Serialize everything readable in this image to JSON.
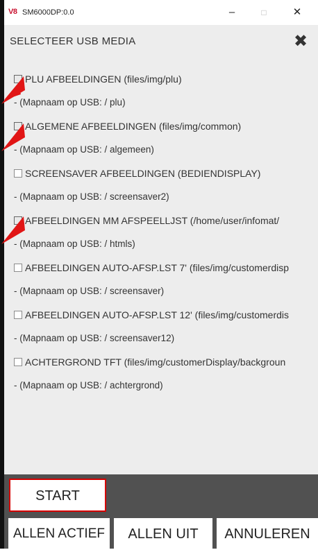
{
  "window": {
    "icon_text": "V8",
    "title": "SM6000DP:0.0",
    "minimize": "–",
    "maximize": "□",
    "close": "✕"
  },
  "dialog": {
    "title": "SELECTEER USB MEDIA",
    "close_icon": "✖"
  },
  "items": [
    {
      "label": "PLU AFBEELDINGEN (files/img/plu)",
      "folder": "- (Mapnaam op USB: / plu)",
      "checked": true
    },
    {
      "label": "ALGEMENE AFBEELDINGEN (files/img/common)",
      "folder": "- (Mapnaam op USB: / algemeen)",
      "checked": true
    },
    {
      "label": "SCREENSAVER AFBEELDINGEN (BEDIENDISPLAY)",
      "folder": "- (Mapnaam op USB: / screensaver2)",
      "checked": false
    },
    {
      "label": "AFBEELDINGEN MM AFSPEELLJST (/home/user/infomat/",
      "folder": "- (Mapnaam op USB: / htmls)",
      "checked": true
    },
    {
      "label": "AFBEELDINGEN AUTO-AFSP.LST 7' (files/img/customerdisp",
      "folder": "- (Mapnaam op USB: / screensaver)",
      "checked": false
    },
    {
      "label": "AFBEELDINGEN AUTO-AFSP.LST 12' (files/img/customerdis",
      "folder": "- (Mapnaam op USB: / screensaver12)",
      "checked": false
    },
    {
      "label": "ACHTERGROND TFT (files/img/customerDisplay/backgroun",
      "folder": "- (Mapnaam op USB: / achtergrond)",
      "checked": false
    }
  ],
  "buttons": {
    "start": "START",
    "allen_actief": "ALLEN ACTIEF",
    "allen_uit": "ALLEN UIT",
    "annuleren": "ANNULEREN"
  },
  "annotation_color": "#e11515"
}
